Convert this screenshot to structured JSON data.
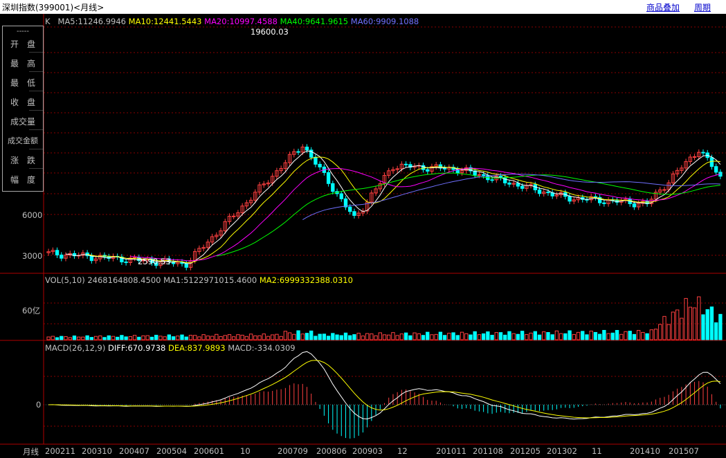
{
  "title": "深圳指数(399001)<月线>",
  "links": {
    "overlay": "商品叠加",
    "period": "周期"
  },
  "info_panel": {
    "dash": "-----",
    "rows": [
      "开　盘",
      "最　高",
      "最　低",
      "收　盘",
      "成交量",
      "成交金额",
      "涨　跌",
      "幅　度"
    ]
  },
  "price_legend": {
    "k": "K",
    "ma5": "MA5:11246.9946",
    "ma10": "MA10:12441.5443",
    "ma20": "MA20:10997.4588",
    "ma40": "MA40:9641.9615",
    "ma60": "MA60:9909.1088"
  },
  "vol_legend": {
    "vol": "VOL(5,10) 2468164808.4500",
    "ma1": "MA1:5122971015.4600",
    "ma2": "MA2:6999332388.0310"
  },
  "macd_legend": {
    "macd": "MACD(26,12,9)",
    "diff": "DIFF:670.9738",
    "dea": "DEA:837.9893",
    "hist": "MACD:-334.0309"
  },
  "price_axis_labels": [
    "6000",
    "3000"
  ],
  "vol_axis_label": "60亿",
  "macd_axis_label": "0",
  "annotations": {
    "high": "19600.03",
    "low": "2590.53"
  },
  "x_axis_title": "月线",
  "x_axis_labels": [
    "200211",
    "200310",
    "200407",
    "200504",
    "200601",
    "10",
    "200709",
    "200806",
    "200903",
    "12",
    "201011",
    "201108",
    "201205",
    "201302",
    "11",
    "201410",
    "201507"
  ],
  "colors": {
    "up": "#ff4040",
    "down": "#00ffff",
    "ma5": "#ffffff",
    "ma10": "#ffff00",
    "ma20": "#ff00ff",
    "ma40": "#00ff00",
    "ma60": "#7070ff",
    "grid": "#8b0000",
    "text": "#c0c0c0"
  },
  "chart_data": {
    "type": "candlestick",
    "title": "深圳指数(399001)<月线>",
    "period": "monthly",
    "x_range": [
      "2002-11",
      "2015-11"
    ],
    "y_range_estimate": [
      2590.53,
      19600.03
    ],
    "price_keypoints": [
      {
        "date": "2002-11",
        "close": 3100
      },
      {
        "date": "2005-07",
        "close": 2600
      },
      {
        "date": "2007-10",
        "close": 19600
      },
      {
        "date": "2008-10",
        "close": 5600
      },
      {
        "date": "2009-07",
        "close": 13700
      },
      {
        "date": "2010-10",
        "close": 13000
      },
      {
        "date": "2012-11",
        "close": 8000
      },
      {
        "date": "2014-06",
        "close": 7200
      },
      {
        "date": "2015-06",
        "close": 18200
      },
      {
        "date": "2015-11",
        "close": 11246
      }
    ],
    "vol_axis_ticks": [
      6000000000
    ],
    "macd_axis_ticks": [
      0
    ]
  }
}
